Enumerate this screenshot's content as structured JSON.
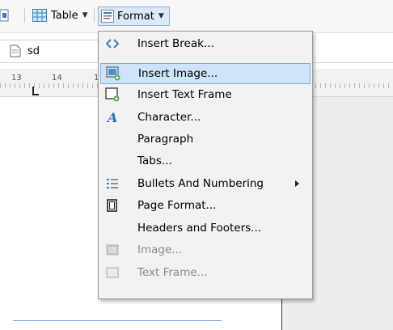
{
  "toolbar": {
    "table_label": "Table",
    "format_label": "Format"
  },
  "document": {
    "tab_name": "sd",
    "ruler_numbers": [
      "13",
      "14",
      "1"
    ]
  },
  "format_menu": {
    "items": [
      {
        "label": "Insert Break...",
        "icon": "code-brackets-icon",
        "enabled": true
      },
      {
        "label": "Insert Image...",
        "icon": "insert-image-icon",
        "enabled": true,
        "highlighted": true
      },
      {
        "label": "Insert Text Frame",
        "icon": "insert-text-frame-icon",
        "enabled": true
      },
      {
        "label": "Character...",
        "icon": "character-a-icon",
        "enabled": true
      },
      {
        "label": "Paragraph",
        "icon": "",
        "enabled": true
      },
      {
        "label": "Tabs...",
        "icon": "",
        "enabled": true
      },
      {
        "label": "Bullets And Numbering",
        "icon": "bullets-icon",
        "enabled": true,
        "submenu": true
      },
      {
        "label": "Page Format...",
        "icon": "page-format-icon",
        "enabled": true
      },
      {
        "label": "Headers and Footers...",
        "icon": "",
        "enabled": true
      },
      {
        "label": "Image...",
        "icon": "image-disabled-icon",
        "enabled": false
      },
      {
        "label": "Text Frame...",
        "icon": "text-frame-disabled-icon",
        "enabled": false
      }
    ]
  },
  "colors": {
    "menu_bg": "#f2f2f2",
    "highlight_bg": "#cde3f7",
    "highlight_border": "#7cb0e6",
    "icon_blue": "#2f7ccb",
    "disabled_text": "#8a8a8a"
  }
}
